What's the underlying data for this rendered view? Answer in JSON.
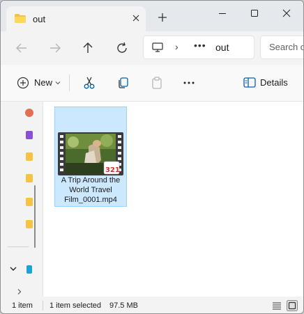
{
  "tab": {
    "title": "out"
  },
  "address": {
    "current_folder": "out",
    "overflow": "•••",
    "separator": "›"
  },
  "search": {
    "placeholder": "Search out"
  },
  "commandbar": {
    "new_label": "New",
    "details_label": "Details"
  },
  "file": {
    "name": "A Trip Around the World Travel Film_0001.mp4",
    "badge": "321"
  },
  "status": {
    "item_count": "1 item",
    "selected": "1 item selected",
    "size": "97.5 MB"
  },
  "colors": {
    "selection_bg": "#cce8ff",
    "selection_border": "#99d1ff",
    "folder_yellow": "#f5c242",
    "accent": "#005fb8"
  },
  "icons": [
    "folder-icon",
    "close-icon",
    "plus-icon",
    "minimize-icon",
    "maximize-icon",
    "window-close-icon",
    "back-arrow-icon",
    "forward-arrow-icon",
    "up-arrow-icon",
    "refresh-icon",
    "computer-icon",
    "chevron-right-icon",
    "new-plus-icon",
    "chevron-down-icon",
    "cut-icon",
    "copy-icon",
    "paste-icon",
    "more-icon",
    "details-pane-icon",
    "details-view-icon",
    "thumbnail-view-icon"
  ]
}
